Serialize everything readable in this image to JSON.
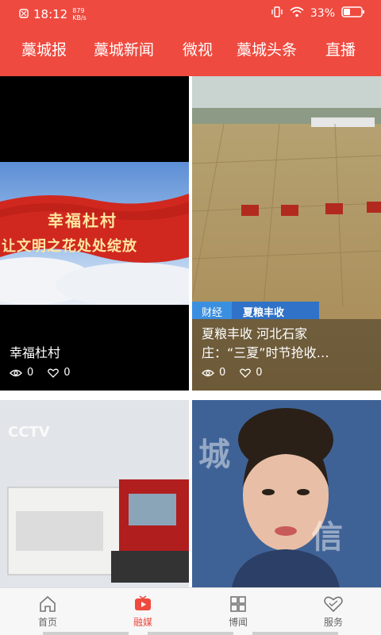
{
  "status": {
    "time": "18:12",
    "speed": "879 KB/s",
    "battery": "33%"
  },
  "nav_tabs": [
    "藁城报",
    "藁城新闻",
    "微视",
    "藁城头条",
    "直播"
  ],
  "cards": [
    {
      "title_lines": [
        "幸福杜村",
        ""
      ],
      "banner_line1": "幸福杜村",
      "banner_line2": "让文明之花处处绽放",
      "views": "0",
      "likes": "0"
    },
    {
      "title_lines": [
        "夏粮丰收 河北石家",
        "庄：“三夏”时节抢收…"
      ],
      "overlay_left": "财经",
      "overlay_right": "夏粮丰收",
      "views": "0",
      "likes": "0"
    },
    {
      "title_lines": [
        "",
        ""
      ],
      "watermark": "CCTV"
    },
    {
      "title_lines": [
        "",
        ""
      ],
      "bg_text1": "城",
      "bg_text2": "信"
    }
  ],
  "bottom_nav": [
    {
      "label": "首页",
      "icon": "home-icon",
      "active": false
    },
    {
      "label": "融媒",
      "icon": "play-tv-icon",
      "active": true
    },
    {
      "label": "博闻",
      "icon": "grid-icon",
      "active": false
    },
    {
      "label": "服务",
      "icon": "heart-icon",
      "active": false
    }
  ],
  "colors": {
    "brand": "#ef4a3f",
    "nav_text": "#666666"
  }
}
